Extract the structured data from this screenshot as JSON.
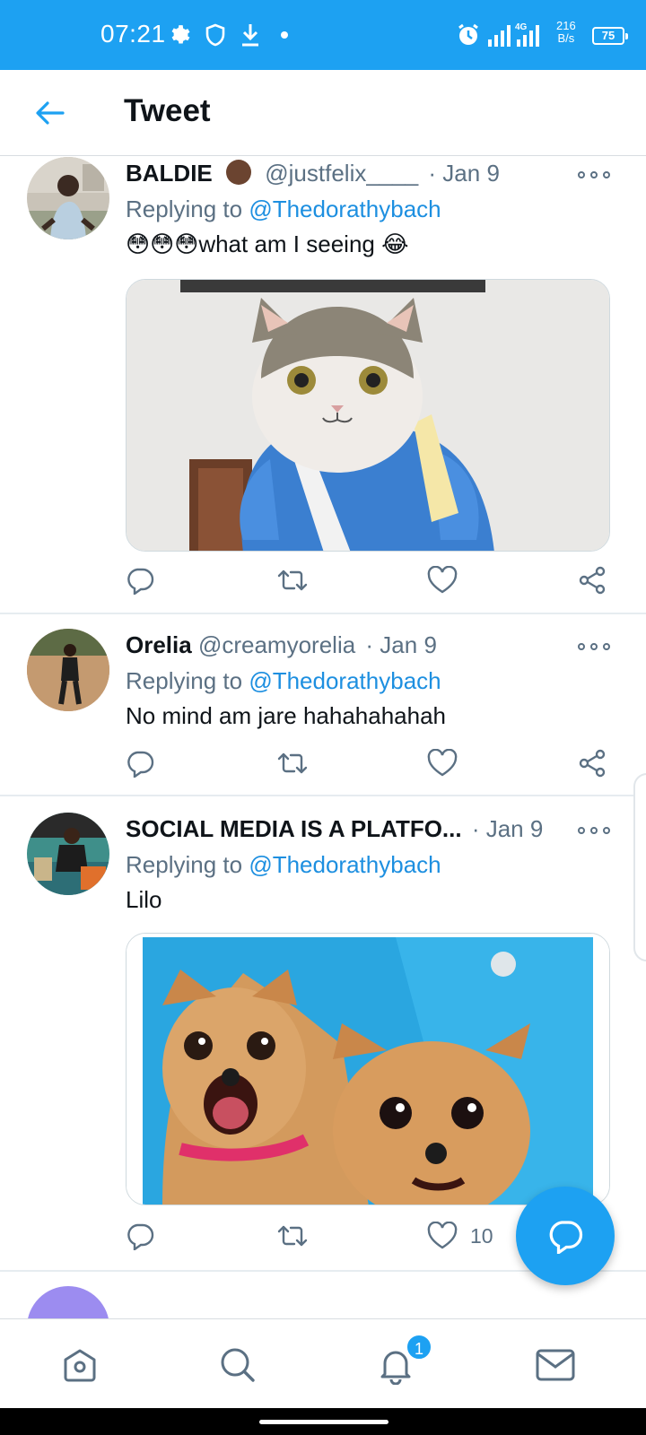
{
  "status_bar": {
    "time": "07:21",
    "network_speed_value": "216",
    "network_speed_unit": "B/s",
    "battery": "75",
    "signal_label": "4G"
  },
  "header": {
    "title": "Tweet"
  },
  "tweets": [
    {
      "name": "BALDIE",
      "handle": "@justfelix____",
      "date": "· Jan 9",
      "replying_label": "Replying to",
      "replying_to": "@Thedorathybach",
      "text": "😳😳😳what am I seeing 😂",
      "likes": ""
    },
    {
      "name": "Orelia",
      "handle": "@creamyorelia",
      "date": "· Jan 9",
      "replying_label": "Replying to",
      "replying_to": "@Thedorathybach",
      "text": "No mind am jare hahahahahah",
      "likes": ""
    },
    {
      "name": "SOCIAL MEDIA IS A PLATFO...",
      "handle": "",
      "date": "· Jan 9",
      "replying_label": "Replying to",
      "replying_to": "@Thedorathybach",
      "text": "Lilo",
      "likes": "10"
    }
  ],
  "bottom_nav": {
    "notification_count": "1"
  },
  "colors": {
    "brand": "#1da1f2",
    "text_primary": "#0f1419",
    "text_secondary": "#5b7083"
  }
}
